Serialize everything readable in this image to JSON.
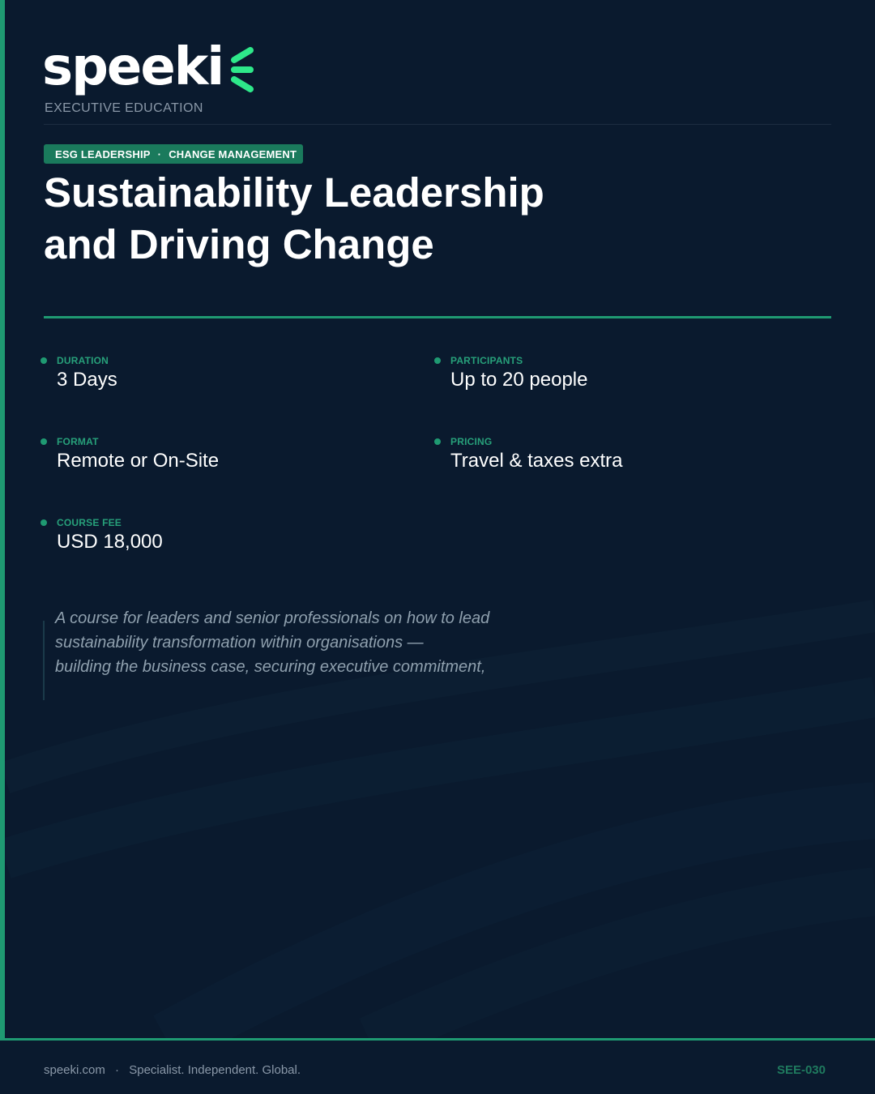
{
  "brand": {
    "name": "speeki",
    "tagline": "EXECUTIVE EDUCATION",
    "accent_color": "#1f9a72",
    "logo_mark_color": "#2ee88a"
  },
  "tags": [
    "ESG LEADERSHIP",
    "CHANGE MANAGEMENT"
  ],
  "tag_separator": "·",
  "title_lines": [
    "Sustainability Leadership",
    "and Driving Change"
  ],
  "details": {
    "duration": {
      "label": "DURATION",
      "value": "3 Days"
    },
    "participants": {
      "label": "PARTICIPANTS",
      "value": "Up to 20 people"
    },
    "format": {
      "label": "FORMAT",
      "value": "Remote or On-Site"
    },
    "pricing": {
      "label": "PRICING",
      "value": "Travel & taxes extra"
    },
    "fee": {
      "label": "COURSE FEE",
      "value": "USD 18,000"
    }
  },
  "description_lines": [
    "A course for leaders and senior professionals on how to lead",
    "sustainability transformation within organisations —",
    "building the business case, securing executive commitment,"
  ],
  "footer": {
    "website": "speeki.com",
    "separator": "·",
    "motto": "Specialist. Independent. Global.",
    "code": "SEE-030"
  }
}
